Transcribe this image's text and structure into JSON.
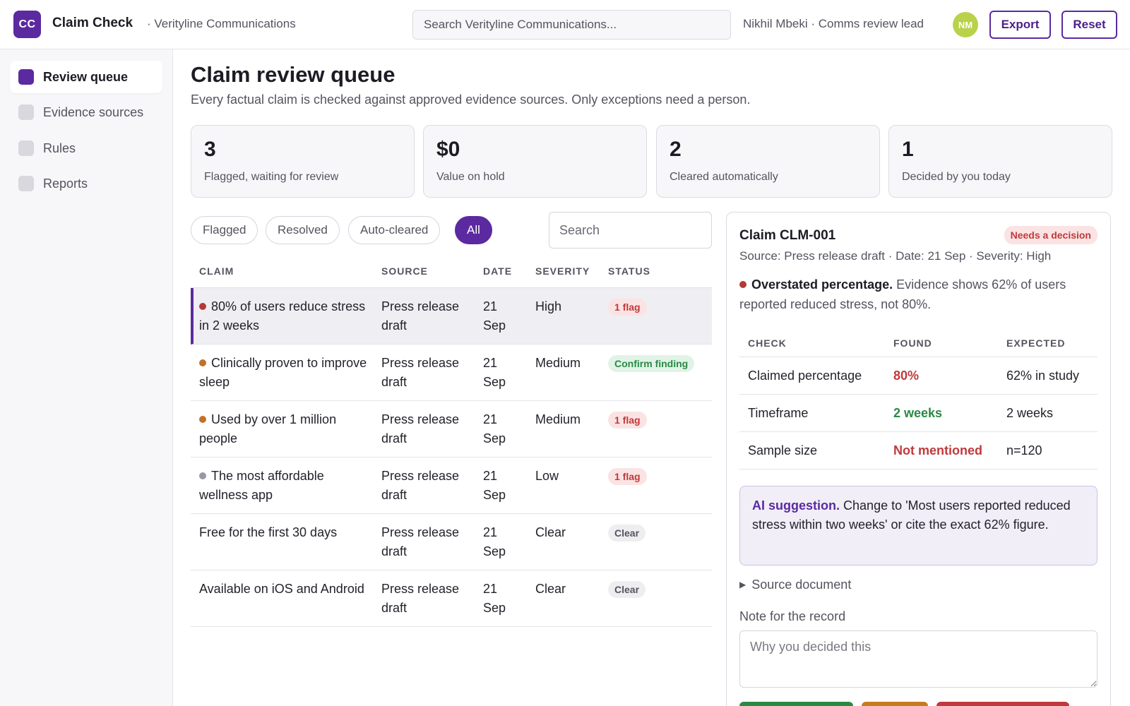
{
  "header": {
    "logo_text": "CC",
    "app_name": "Claim Check",
    "org": "· Verityline Communications",
    "search_placeholder": "Search Verityline Communications...",
    "user": "Nikhil Mbeki · Comms review lead",
    "avatar": "NM",
    "export_label": "Export",
    "reset_label": "Reset"
  },
  "sidebar": {
    "items": [
      {
        "label": "Review queue",
        "active": true
      },
      {
        "label": "Evidence sources",
        "active": false
      },
      {
        "label": "Rules",
        "active": false
      },
      {
        "label": "Reports",
        "active": false
      }
    ]
  },
  "main": {
    "title": "Claim review queue",
    "subtitle": "Every factual claim is checked against approved evidence sources. Only exceptions need a person.",
    "stats": [
      {
        "value": "3",
        "label": "Flagged, waiting for review"
      },
      {
        "value": "$0",
        "label": "Value on hold"
      },
      {
        "value": "2",
        "label": "Cleared automatically"
      },
      {
        "value": "1",
        "label": "Decided by you today"
      }
    ],
    "filters": [
      "Flagged",
      "Resolved",
      "Auto-cleared",
      "All"
    ],
    "active_filter": "All",
    "table_search_placeholder": "Search",
    "columns": [
      "CLAIM",
      "SOURCE",
      "DATE",
      "SEVERITY",
      "STATUS"
    ],
    "rows": [
      {
        "claim": "80% of users reduce stress in 2 weeks",
        "dot": "#b23a3a",
        "source": "Press release draft",
        "date": "21 Sep",
        "severity": "High",
        "status": "1 flag",
        "status_kind": "flag"
      },
      {
        "claim": "Clinically proven to improve sleep",
        "dot": "#c2702a",
        "source": "Press release draft",
        "date": "21 Sep",
        "severity": "Medium",
        "status": "Confirm finding",
        "status_kind": "confirm"
      },
      {
        "claim": "Used by over 1 million people",
        "dot": "#c2702a",
        "source": "Press release draft",
        "date": "21 Sep",
        "severity": "Medium",
        "status": "1 flag",
        "status_kind": "flag"
      },
      {
        "claim": "The most affordable wellness app",
        "dot": "#9896a8",
        "source": "Press release draft",
        "date": "21 Sep",
        "severity": "Low",
        "status": "1 flag",
        "status_kind": "flag"
      },
      {
        "claim": "Free for the first 30 days",
        "dot": "",
        "source": "Press release draft",
        "date": "21 Sep",
        "severity": "Clear",
        "status": "Clear",
        "status_kind": "clear"
      },
      {
        "claim": "Available on iOS and Android",
        "dot": "",
        "source": "Press release draft",
        "date": "21 Sep",
        "severity": "Clear",
        "status": "Clear",
        "status_kind": "clear"
      }
    ]
  },
  "detail": {
    "title": "Claim CLM-001",
    "badge": "Needs a decision",
    "meta": "Source: Press release draft · Date: 21 Sep · Severity: High",
    "finding_title": "Overstated percentage.",
    "finding_text": "Evidence shows 62% of users reported reduced stress, not 80%.",
    "check_columns": [
      "CHECK",
      "FOUND",
      "EXPECTED"
    ],
    "checks": [
      {
        "check": "Claimed percentage",
        "found": "80%",
        "expected": "62% in study",
        "ok": false
      },
      {
        "check": "Timeframe",
        "found": "2 weeks",
        "expected": "2 weeks",
        "ok": true
      },
      {
        "check": "Sample size",
        "found": "Not mentioned",
        "expected": "n=120",
        "ok": false
      }
    ],
    "ai_title": "AI suggestion.",
    "ai_text": "Change to 'Most users reported reduced stress within two weeks' or cite the exact 62% figure.",
    "source_doc_label": "Source document",
    "note_label": "Note for the record",
    "note_placeholder": "Why you decided this"
  },
  "colors": {
    "accent": "#5b2aa0",
    "danger": "#c0393b",
    "success": "#2a8a45",
    "warning": "#c77a1e",
    "avatar": "#b8d24a"
  }
}
